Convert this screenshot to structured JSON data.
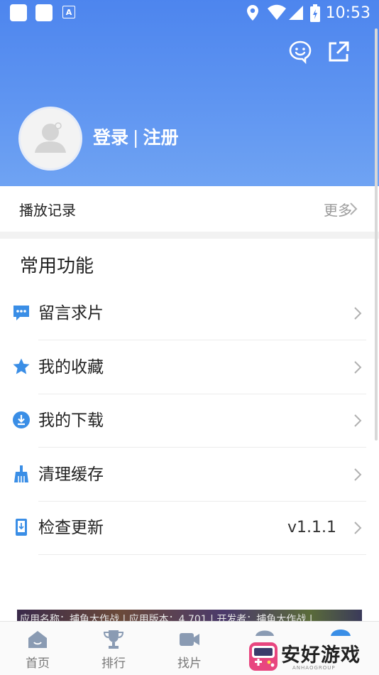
{
  "status_bar": {
    "time": "10:53"
  },
  "user": {
    "login_label": "登录",
    "separator": "|",
    "register_label": "注册"
  },
  "history": {
    "title": "播放记录",
    "more_label": "更多"
  },
  "section": {
    "title": "常用功能"
  },
  "menu": [
    {
      "label": "留言求片",
      "value": "",
      "icon": "message-icon"
    },
    {
      "label": "我的收藏",
      "value": "",
      "icon": "star-icon"
    },
    {
      "label": "我的下载",
      "value": "",
      "icon": "download-icon"
    },
    {
      "label": "清理缓存",
      "value": "",
      "icon": "broom-icon"
    },
    {
      "label": "检查更新",
      "value": "v1.1.1",
      "icon": "update-icon"
    }
  ],
  "banner": {
    "text": "应用名称：捕鱼大作战 | 应用版本：4.701 | 开发者：捕鱼大作战 |"
  },
  "tabs": [
    {
      "label": "首页",
      "icon": "home-icon"
    },
    {
      "label": "排行",
      "icon": "trophy-icon"
    },
    {
      "label": "找片",
      "icon": "video-icon"
    }
  ],
  "watermark": {
    "text": "安好游戏",
    "sub": "ANHAOGROUP"
  },
  "colors": {
    "header": "#5b8ff0",
    "accent": "#3a8ee6",
    "muted": "#9a9a9a"
  }
}
